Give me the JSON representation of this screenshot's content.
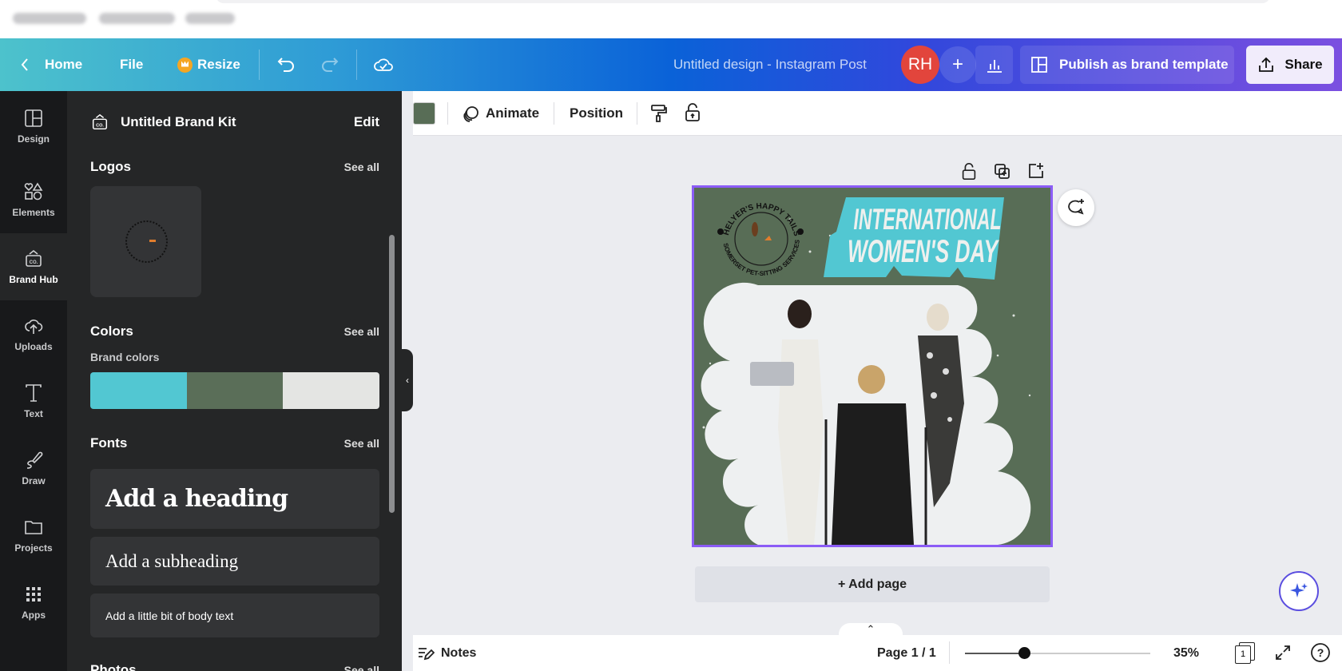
{
  "topbar": {
    "home": "Home",
    "file": "File",
    "resize": "Resize",
    "title": "Untitled design - Instagram Post",
    "avatar_initials": "RH",
    "add_label": "+",
    "publish": "Publish as brand template",
    "share": "Share"
  },
  "rail": {
    "items": [
      {
        "label": "Design",
        "icon": "layout-icon"
      },
      {
        "label": "Elements",
        "icon": "shapes-icon"
      },
      {
        "label": "Brand Hub",
        "icon": "brand-kit-icon"
      },
      {
        "label": "Uploads",
        "icon": "cloud-upload-icon"
      },
      {
        "label": "Text",
        "icon": "text-icon"
      },
      {
        "label": "Draw",
        "icon": "pen-icon"
      },
      {
        "label": "Projects",
        "icon": "folder-icon"
      },
      {
        "label": "Apps",
        "icon": "grid-icon"
      }
    ],
    "active": "Brand Hub"
  },
  "panel": {
    "kit_name": "Untitled Brand Kit",
    "edit": "Edit",
    "logos": {
      "title": "Logos",
      "see_all": "See all"
    },
    "colors": {
      "title": "Colors",
      "see_all": "See all",
      "subtitle": "Brand colors",
      "swatches": [
        "#52c7d2",
        "#5a6e58",
        "#e4e5e3"
      ]
    },
    "fonts": {
      "title": "Fonts",
      "see_all": "See all",
      "heading": "Add a heading",
      "subheading": "Add a subheading",
      "body": "Add a little bit of body text"
    },
    "photos": {
      "title": "Photos",
      "see_all": "See all"
    }
  },
  "toolbar": {
    "color": "#586d56",
    "animate": "Animate",
    "position": "Position"
  },
  "design": {
    "headline_1": "INTERNATIONAL",
    "headline_2": "WOMEN'S DAY",
    "logo_top": "HELYER'S HAPPY TAILS",
    "logo_bottom": "SOMERSET PET-SITTING SERVICES",
    "accent": "#52c7d2",
    "background": "#586d56"
  },
  "canvas": {
    "add_page": "+ Add page"
  },
  "bottombar": {
    "notes": "Notes",
    "page": "Page 1 / 1",
    "zoom": "35%",
    "zoom_percent": 35,
    "page_count": "1"
  }
}
